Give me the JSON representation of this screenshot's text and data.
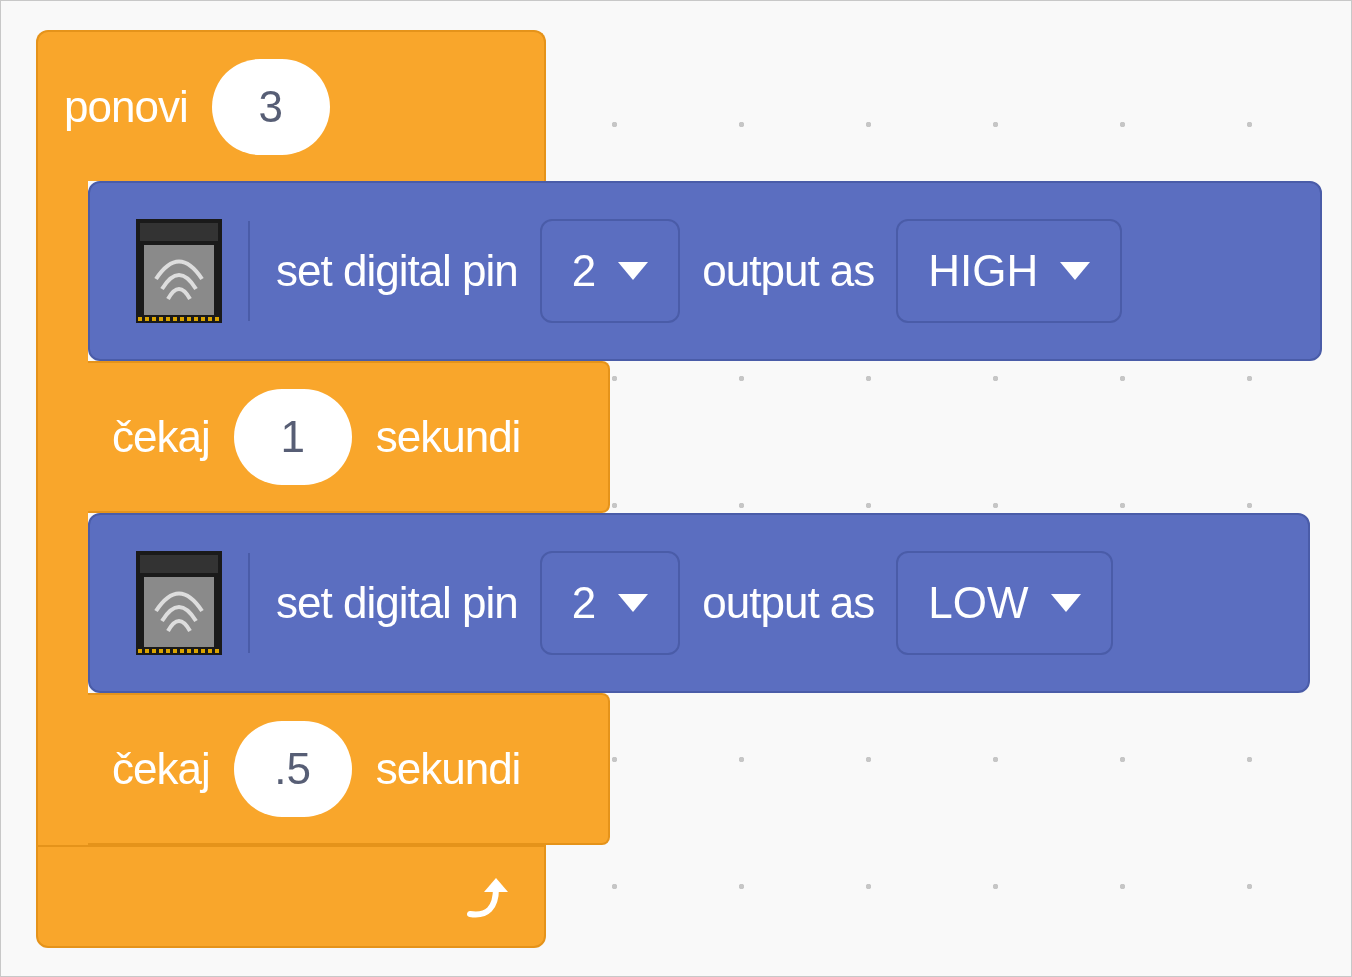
{
  "repeat": {
    "label": "ponovi",
    "count": "3"
  },
  "body": [
    {
      "kind": "digital_write",
      "label": "set digital pin",
      "pin": "2",
      "output_label": "output as",
      "value": "HIGH"
    },
    {
      "kind": "wait",
      "label": "čekaj",
      "seconds": "1",
      "unit": "sekundi"
    },
    {
      "kind": "digital_write",
      "label": "set digital pin",
      "pin": "2",
      "output_label": "output as",
      "value": "LOW"
    },
    {
      "kind": "wait",
      "label": "čekaj",
      "seconds": ".5",
      "unit": "sekundi"
    }
  ]
}
